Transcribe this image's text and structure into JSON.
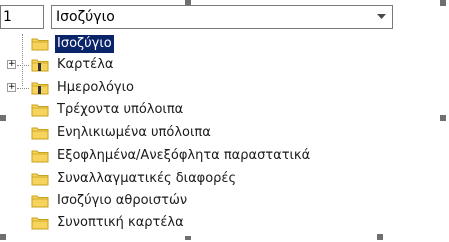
{
  "left_field": {
    "value": "1"
  },
  "combo": {
    "value": "Ισοζύγιο"
  },
  "tree": {
    "items": [
      {
        "label": "Ισοζύγιο",
        "selected": true,
        "expandable": false
      },
      {
        "label": "Καρτέλα",
        "selected": false,
        "expandable": true
      },
      {
        "label": "Ημερολόγιο",
        "selected": false,
        "expandable": true
      },
      {
        "label": "Τρέχοντα υπόλοιπα",
        "selected": false,
        "expandable": false
      },
      {
        "label": "Ενηλικιωμένα υπόλοιπα",
        "selected": false,
        "expandable": false
      },
      {
        "label": "Εξοφλημένα/Ανεξόφλητα παραστατικά",
        "selected": false,
        "expandable": false
      },
      {
        "label": "Συναλλαγματικές διαφορές",
        "selected": false,
        "expandable": false
      },
      {
        "label": "Ισοζύγιο αθροιστών",
        "selected": false,
        "expandable": false
      },
      {
        "label": "Συνοπτική καρτέλα",
        "selected": false,
        "expandable": false
      }
    ]
  },
  "colors": {
    "selection": "#0a246a",
    "folder": "#f5d35c",
    "folder_dark": "#c9a21e"
  }
}
